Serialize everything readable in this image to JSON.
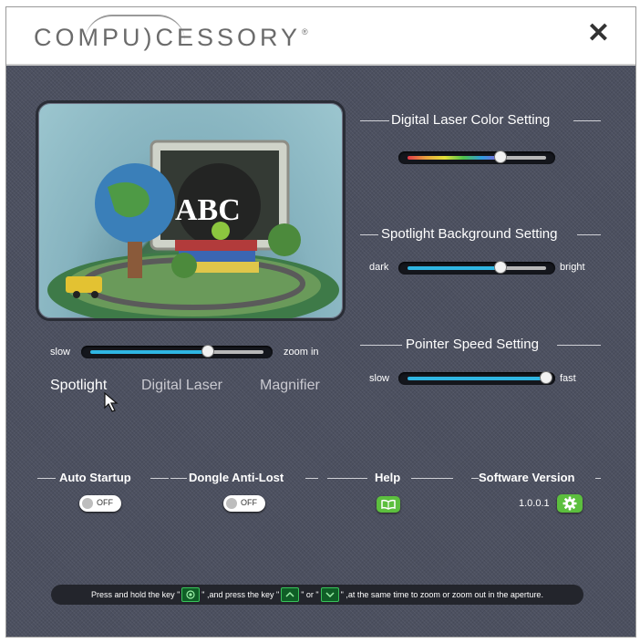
{
  "header": {
    "logo_text": "COMPU)CESSORY",
    "logo_mark": "®",
    "close_icon": "close-icon"
  },
  "settings": {
    "laser_color_title": "Digital Laser Color Setting",
    "laser_color_level": 0.67,
    "background_title": "Spotlight Background Setting",
    "background_min": "dark",
    "background_max": "bright",
    "background_level": 0.67,
    "pointer_title": "Pointer Speed Setting",
    "pointer_min": "slow",
    "pointer_max": "fast",
    "pointer_level": 1.0
  },
  "zoom": {
    "min_label": "slow",
    "max_label": "zoom in",
    "level": 0.68
  },
  "modes": [
    {
      "label": "Spotlight",
      "active": true
    },
    {
      "label": "Digital Laser",
      "active": false
    },
    {
      "label": "Magnifier",
      "active": false
    }
  ],
  "features": {
    "auto_startup": {
      "title": "Auto Startup",
      "state": "OFF"
    },
    "dongle": {
      "title": "Dongle Anti-Lost",
      "state": "OFF"
    },
    "help": {
      "title": "Help",
      "icon": "book-icon"
    },
    "version": {
      "title": "Software Version",
      "value": "1.0.0.1",
      "icon": "gear-icon"
    }
  },
  "hint": {
    "part1": "Press and hold the key \"",
    "part2": "\" ,and press the key \"",
    "part3": "\" or \"",
    "part4": "\" ,at the same time to zoom or zoom out in the aperture."
  },
  "colors": {
    "accent_blue": "#2fb6e3",
    "toggle_green": "#5cbf3e",
    "panel_bg": "#4c5060"
  }
}
